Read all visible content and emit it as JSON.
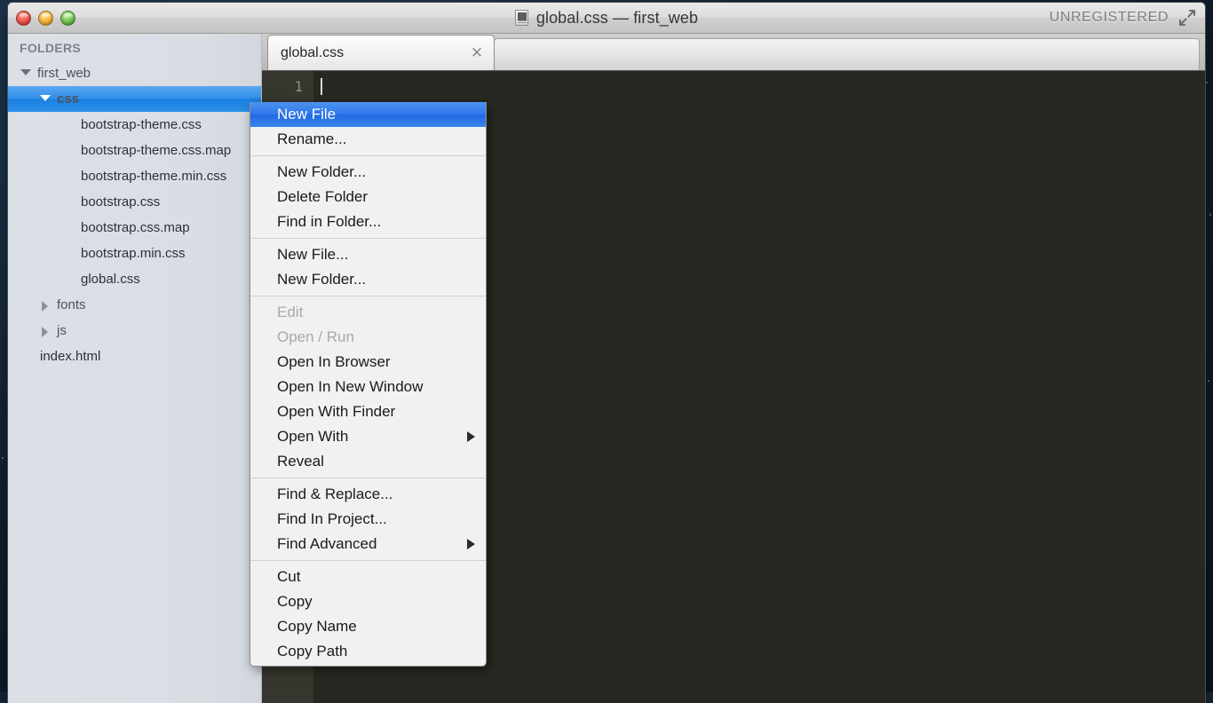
{
  "window": {
    "title": "global.css — first_web",
    "doc_icon": "document-icon",
    "unregistered_label": "UNREGISTERED",
    "fullscreen_icon": "fullscreen-arrows-icon",
    "traffic_lights": {
      "close": "close-button",
      "minimize": "minimize-button",
      "zoom": "zoom-button"
    }
  },
  "sidebar": {
    "header": "FOLDERS",
    "tree": [
      {
        "label": "first_web",
        "depth": 0,
        "type": "folder",
        "expanded": true,
        "selected": false
      },
      {
        "label": "css",
        "depth": 1,
        "type": "folder",
        "expanded": true,
        "selected": true
      },
      {
        "label": "bootstrap-theme.css",
        "depth": 2,
        "type": "file",
        "selected": false
      },
      {
        "label": "bootstrap-theme.css.map",
        "depth": 2,
        "type": "file",
        "selected": false
      },
      {
        "label": "bootstrap-theme.min.css",
        "depth": 2,
        "type": "file",
        "selected": false
      },
      {
        "label": "bootstrap.css",
        "depth": 2,
        "type": "file",
        "selected": false
      },
      {
        "label": "bootstrap.css.map",
        "depth": 2,
        "type": "file",
        "selected": false
      },
      {
        "label": "bootstrap.min.css",
        "depth": 2,
        "type": "file",
        "selected": false
      },
      {
        "label": "global.css",
        "depth": 2,
        "type": "file",
        "selected": false
      },
      {
        "label": "fonts",
        "depth": 1,
        "type": "folder",
        "expanded": false,
        "selected": false
      },
      {
        "label": "js",
        "depth": 1,
        "type": "folder",
        "expanded": false,
        "selected": false
      },
      {
        "label": "index.html",
        "depth": 1,
        "type": "file",
        "selected": false
      }
    ]
  },
  "editor": {
    "tab": {
      "label": "global.css",
      "close_icon": "close-tab-icon"
    },
    "gutter_lines": [
      "1"
    ],
    "lines": [
      ""
    ]
  },
  "context_menu": {
    "groups": [
      {
        "items": [
          {
            "label": "New File",
            "state": "highlighted"
          },
          {
            "label": "Rename...",
            "state": "normal"
          }
        ]
      },
      {
        "items": [
          {
            "label": "New Folder...",
            "state": "normal"
          },
          {
            "label": "Delete Folder",
            "state": "normal"
          },
          {
            "label": "Find in Folder...",
            "state": "normal"
          }
        ]
      },
      {
        "items": [
          {
            "label": "New File...",
            "state": "normal"
          },
          {
            "label": "New Folder...",
            "state": "normal"
          }
        ]
      },
      {
        "items": [
          {
            "label": "Edit",
            "state": "disabled"
          },
          {
            "label": "Open / Run",
            "state": "disabled"
          },
          {
            "label": "Open In Browser",
            "state": "normal"
          },
          {
            "label": "Open In New Window",
            "state": "normal"
          },
          {
            "label": "Open With Finder",
            "state": "normal"
          },
          {
            "label": "Open With",
            "state": "normal",
            "submenu": true
          },
          {
            "label": "Reveal",
            "state": "normal"
          }
        ]
      },
      {
        "items": [
          {
            "label": "Find & Replace...",
            "state": "normal"
          },
          {
            "label": "Find In Project...",
            "state": "normal"
          },
          {
            "label": "Find Advanced",
            "state": "normal",
            "submenu": true
          }
        ]
      },
      {
        "items": [
          {
            "label": "Cut",
            "state": "normal"
          },
          {
            "label": "Copy",
            "state": "normal"
          },
          {
            "label": "Copy Name",
            "state": "normal"
          },
          {
            "label": "Copy Path",
            "state": "normal"
          }
        ]
      }
    ]
  },
  "colors": {
    "selection_blue": "#2e8de8",
    "editor_background": "#272821",
    "gutter_background": "#35362d",
    "sidebar_background": "#dbe0e7",
    "menu_background": "#f1f1f1",
    "menu_highlight": "#2f76e8",
    "disabled_text": "#a9a9a9"
  }
}
